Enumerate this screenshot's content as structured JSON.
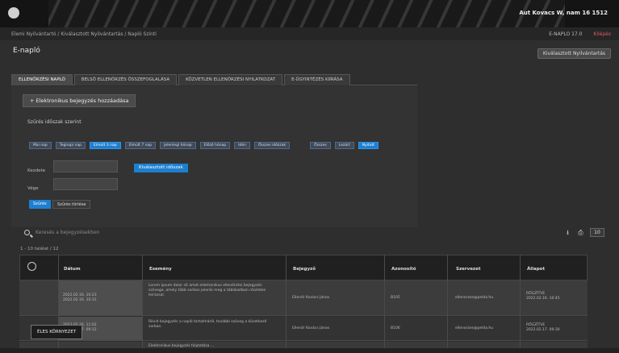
{
  "topbar": {
    "user": "Aut Kovacs W, nam 16 1512"
  },
  "breadcrumb": {
    "path": "Elemi Nyilvántartó / Kiválasztott Nyilvántartás / Napló Szinti",
    "ekapu": "E-NAPLO 17.0",
    "exit": "Kilépés"
  },
  "page": {
    "title": "E-napló",
    "help": "Kiválasztott Nyilvántartás"
  },
  "tabs": [
    "ELLENŐRZÉSI NAPLÓ",
    "BELSŐ ELLENŐRZÉS ÖSSZEFOGLALÁSA",
    "KÖZVETLEN ELLENŐRZÉSI NYILATKOZAT",
    "E-ÜGYINTÉZÉS KIÍRÁSA"
  ],
  "panel": {
    "new_button": "+ Elektronikus bejegyzés hozzáadása",
    "filter_label": "Szűrés időszak szerint",
    "chips": [
      "Mai nap",
      "Tegnapi nap",
      "Elmúlt 3 nap",
      "Elmúlt 7 nap",
      "Jelenlegi hónap",
      "Előző hónap",
      "Idén",
      "Összes időszak",
      "Összes",
      "Lezárt",
      "Nyitott"
    ],
    "from_label": "Kezdete",
    "to_label": "Vége",
    "select_button": "Kiválasztott időszak",
    "ok_button": "Szűrés",
    "clear_button": "Szűrés törlése"
  },
  "search": {
    "placeholder": "Keresés a bejegyzésekben"
  },
  "tools": {
    "download": "⭳",
    "print": "⎙",
    "perpage": "10"
  },
  "count": "1 - 10 találat / 12",
  "table": {
    "headers": [
      "Dátum",
      "Esemény",
      "Bejegyző",
      "Szervezet",
      "Azonosító",
      "Állapot"
    ],
    "rows": [
      {
        "date": "2022.02.16. 10:23\n2022.02.16. 10:31",
        "text": "Lorem ipsum dolor sit amet elektronikus ellenőrzési bejegyzés szövege, amely több sorban jelenik meg a táblázatban részletes leírással.",
        "who": "Ellenőr Kovács János",
        "code": "B105",
        "email": "ellenorzes@pelda.hu",
        "status": "RÖGZÍTVE\n2022.02.16. 10:45"
      },
      {
        "date": "2022.02.16. 11:02\n2022.02.17. 09:12",
        "text": "Rövid bejegyzés a napló tartalmáról, további szöveg a következő sorban.",
        "who": "Ellenőr Kovács János",
        "code": "B106",
        "email": "ellenorzes@pelda.hu",
        "status": "RÖGZÍTVE\n2022.02.17. 09:30"
      },
      {
        "date": "",
        "text": "Elektronikus bejegyzés folytatása ...",
        "who": "",
        "code": "",
        "email": "",
        "status": ""
      }
    ]
  },
  "floating": {
    "label": "ÉLES KÖRNYEZET"
  }
}
